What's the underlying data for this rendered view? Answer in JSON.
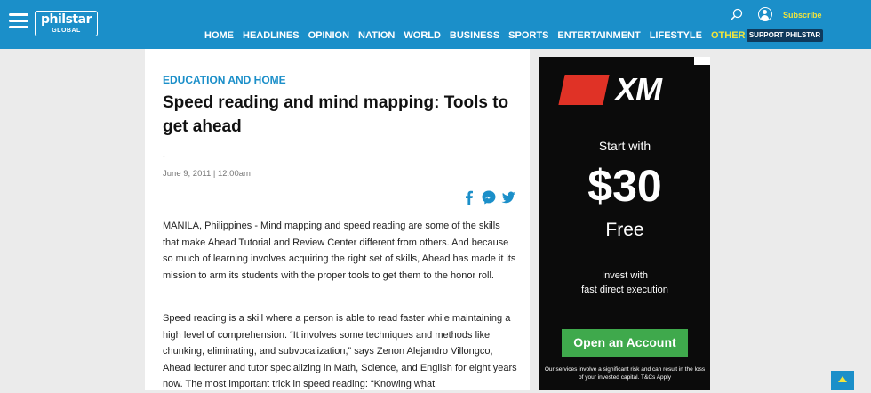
{
  "brand": {
    "logo_main": "philstar",
    "logo_sub": "GLOBAL"
  },
  "header": {
    "nav": [
      "HOME",
      "HEADLINES",
      "OPINION",
      "NATION",
      "WORLD",
      "BUSINESS",
      "SPORTS",
      "ENTERTAINMENT",
      "LIFESTYLE",
      "OTHER SECTIONS"
    ],
    "support_label": "SUPPORT PHILSTAR",
    "subscribe_label": "Subscribe"
  },
  "article": {
    "category": "EDUCATION AND HOME",
    "title": "Speed reading and mind mapping: Tools to get ahead",
    "byline_dash": "-",
    "date": "June 9, 2011 | 12:00am",
    "paragraphs": [
      "MANILA, Philippines -  Mind mapping and speed reading are some of the skills that make Ahead Tutorial and Review Center different from others. And because so much of learning involves acquiring the right set of skills, Ahead has made it its mission to arm its students with the proper tools to get them to the honor roll.",
      "Speed reading is a skill where a person is able to read faster while maintaining a high level of comprehension. “It involves some techniques and methods like chunking, eliminating, and subvocalization,” says Zenon Alejandro Villongco, Ahead lecturer and tutor specializing in Math, Science, and English for eight years now. The most important trick in speed reading: “Knowing what"
    ]
  },
  "ad": {
    "brand": "XM",
    "start_with": "Start with",
    "amount": "$30",
    "free": "Free",
    "invest_line1": "Invest with",
    "invest_line2": "fast direct execution",
    "cta": "Open an Account",
    "disclaimer": "Our services involve a significant risk and can result in the loss of your invested capital. T&Cs Apply"
  },
  "colors": {
    "primary": "#1b8fc9",
    "accent": "#f2e53c",
    "ad_green": "#3fa94c",
    "ad_red": "#e03226"
  }
}
